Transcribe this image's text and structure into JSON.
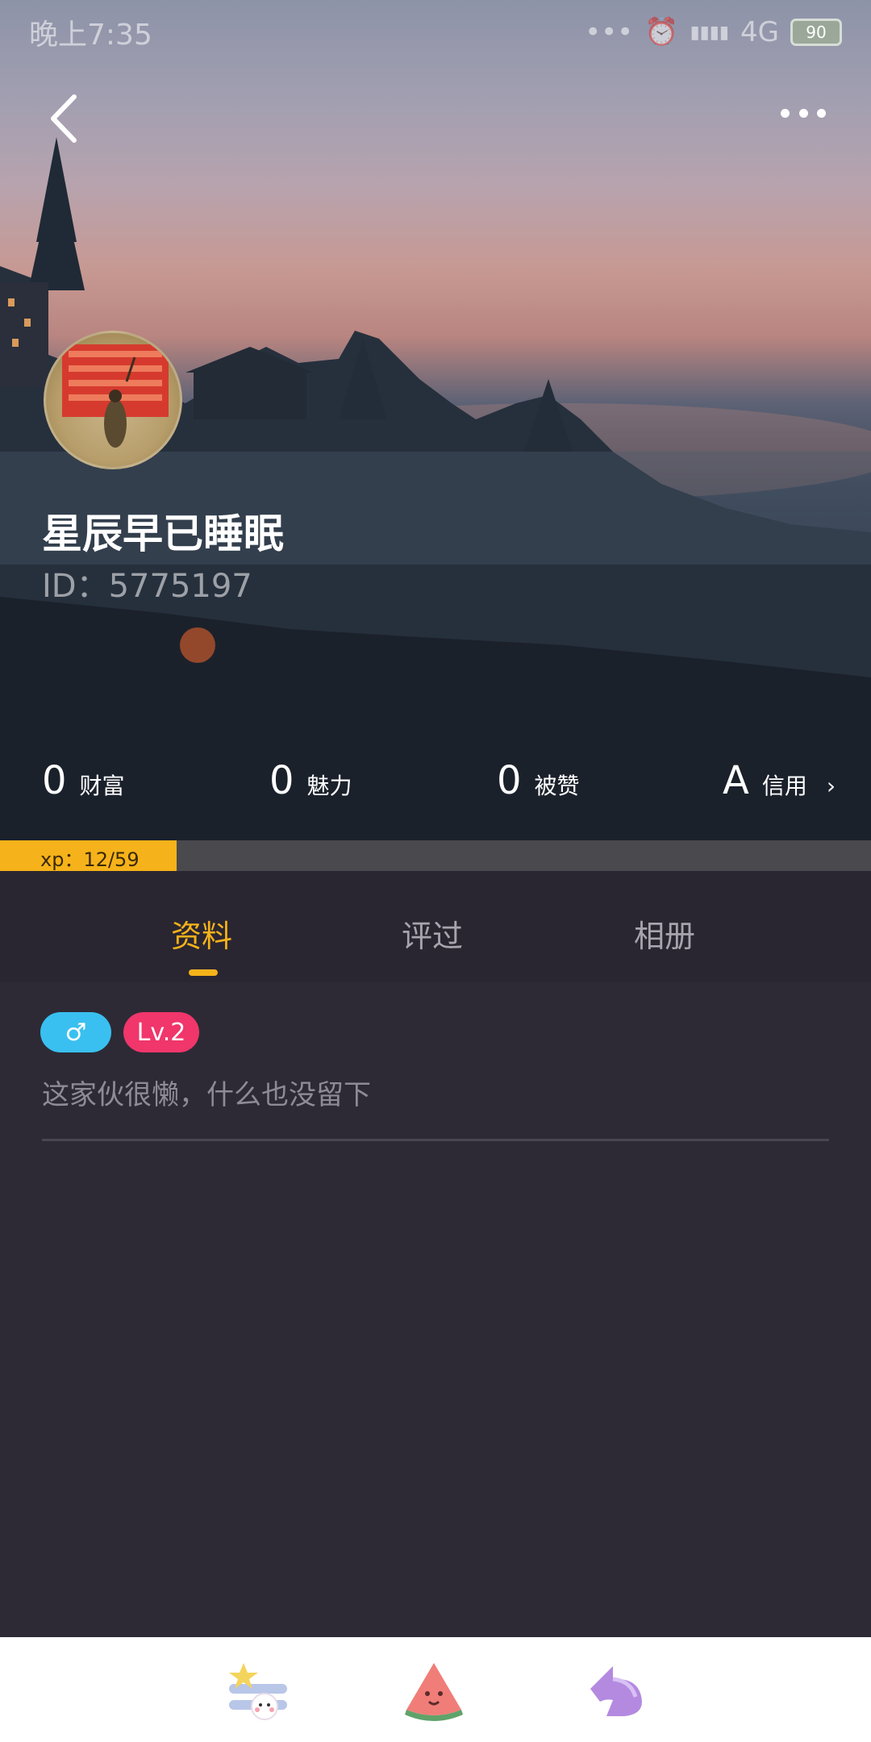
{
  "status_bar": {
    "time": "晚上7:35",
    "network": "4G",
    "signal_glyph": "▮▮▮▮",
    "dots": "•••",
    "battery": "90"
  },
  "header": {
    "back_icon": "chevron-left-icon",
    "more_icon": "more-dots-icon"
  },
  "profile": {
    "name": "星辰早已睡眠",
    "id_text": "ID：5775197"
  },
  "stats": [
    {
      "value": "0",
      "label": "财富"
    },
    {
      "value": "0",
      "label": "魅力"
    },
    {
      "value": "0",
      "label": "被赞"
    },
    {
      "value": "A",
      "label": "信用",
      "chevron": "›"
    }
  ],
  "xp": {
    "text": "xp：12/59",
    "current": 12,
    "max": 59
  },
  "tabs": [
    {
      "label": "资料",
      "active": true
    },
    {
      "label": "评过",
      "active": false
    },
    {
      "label": "相册",
      "active": false
    }
  ],
  "badges": {
    "gender": "♂",
    "level": "Lv.2"
  },
  "bio": "这家伙很懒，什么也没留下",
  "bottom_nav": [
    {
      "icon": "star-bunny-icon"
    },
    {
      "icon": "watermelon-icon"
    },
    {
      "icon": "purple-arrow-icon"
    }
  ],
  "colors": {
    "accent": "#f5b21a",
    "gender_badge": "#39c0f0",
    "level_badge": "#f0366b",
    "page_bg": "#2d2a36"
  }
}
